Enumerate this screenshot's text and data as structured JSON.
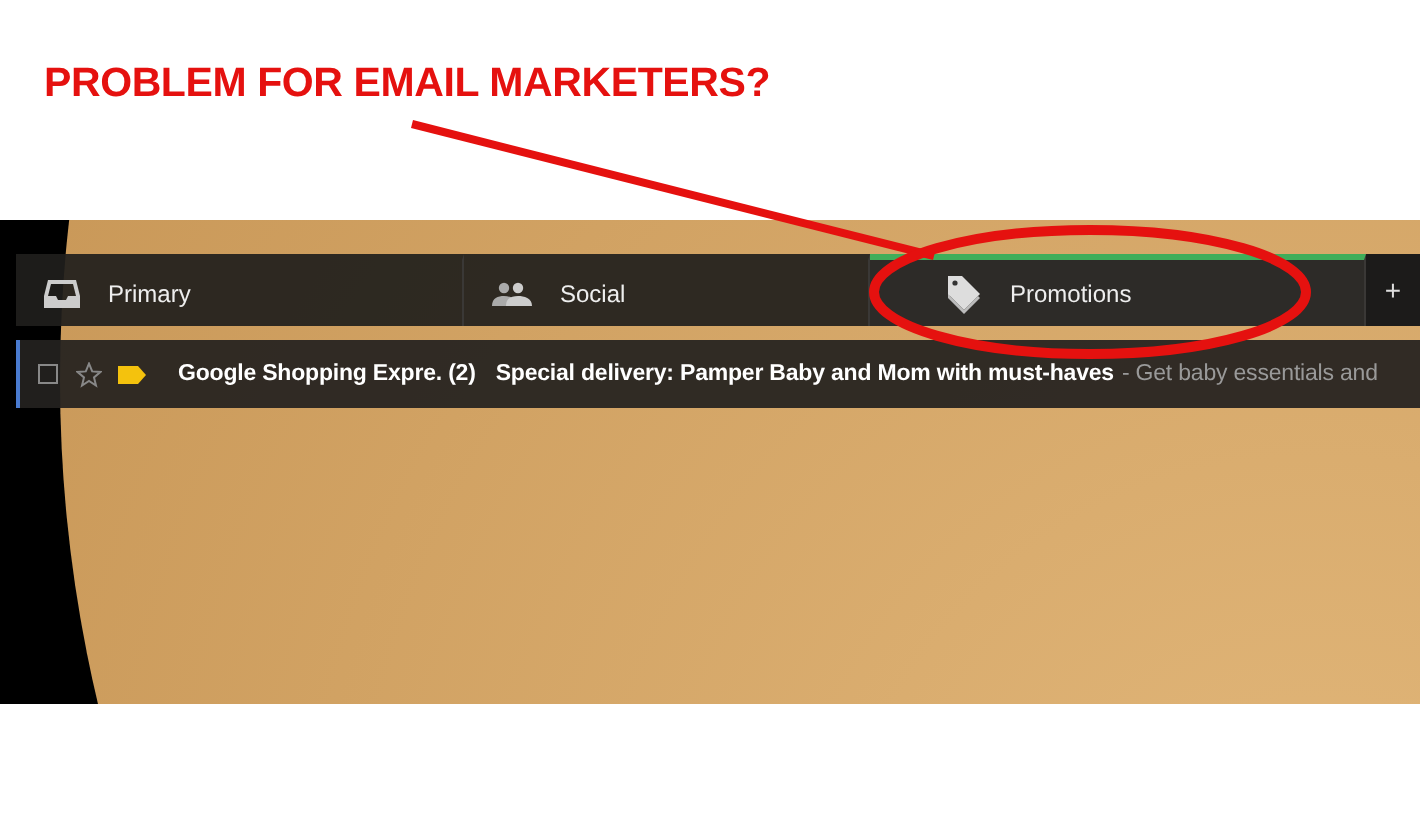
{
  "headline": "PROBLEM FOR EMAIL MARKETERS?",
  "tabs": [
    {
      "label": "Primary",
      "kind": "inbox",
      "selected": false
    },
    {
      "label": "Social",
      "kind": "people",
      "selected": false
    },
    {
      "label": "Promotions",
      "kind": "tag",
      "selected": true
    }
  ],
  "add_tab": "+",
  "email": {
    "checked": false,
    "starred": false,
    "sender": "Google Shopping Expre. (2)",
    "subject": "Special delivery: Pamper Baby and Mom with must-haves",
    "snippet": "- Get baby essentials and"
  }
}
